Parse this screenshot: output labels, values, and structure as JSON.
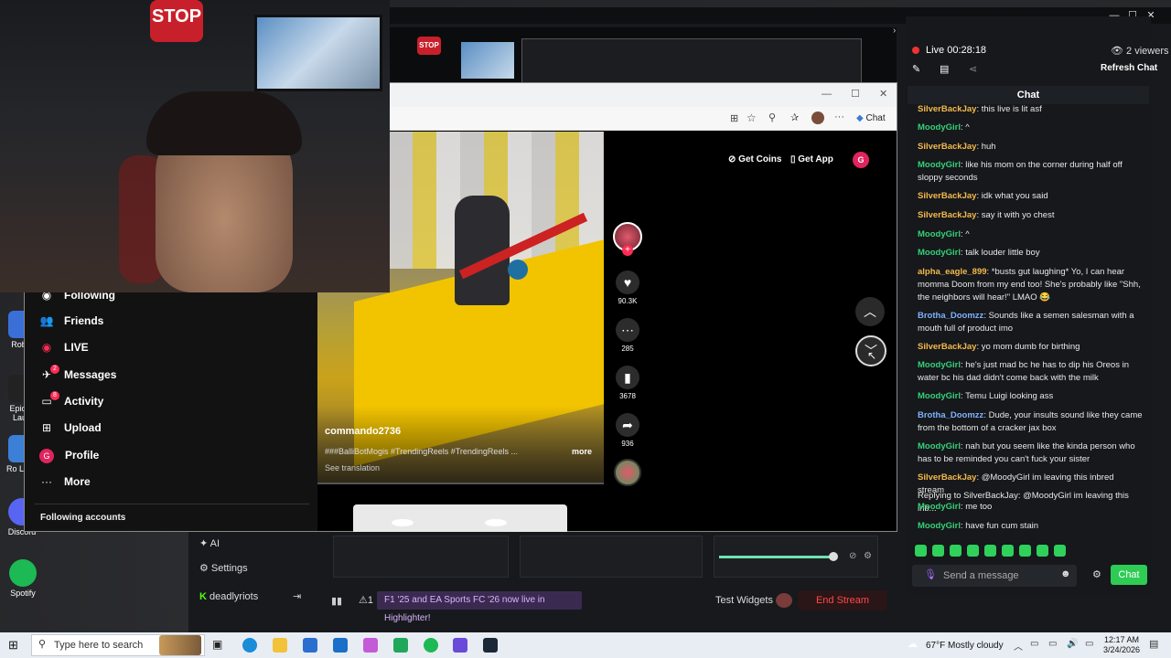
{
  "desktop": {
    "icons": [
      {
        "label": "Roblo"
      },
      {
        "label": "Epic G Laun"
      },
      {
        "label": "Ro Leag"
      },
      {
        "label": "Discord"
      },
      {
        "label": "Spotify"
      }
    ]
  },
  "webcam": {
    "stop_text": "STOP"
  },
  "stream_app": {
    "preview_stop": "STOP",
    "menu": [
      {
        "label": "AI"
      },
      {
        "label": "Settings"
      },
      {
        "label": "deadlyriots"
      }
    ],
    "ticker": "F1 '25 and EA Sports FC '26 now live in Highlighter!",
    "alert_count": "1",
    "test_widgets": "Test Widgets",
    "end_stream": "End Stream"
  },
  "chat": {
    "live_label": "Live 00:28:18",
    "viewers": "2 viewers",
    "refresh": "Refresh Chat",
    "header": "Chat",
    "messages": [
      {
        "user": "SilverBackJay",
        "text": ": this live is lit asf",
        "color": "#f5b94c"
      },
      {
        "user": "MoodyGirl",
        "text": ": ^",
        "color": "#36d07a"
      },
      {
        "user": "SilverBackJay",
        "text": ": huh",
        "color": "#f5b94c"
      },
      {
        "user": "MoodyGirl",
        "text": ": like his mom on the corner during half off sloppy seconds",
        "color": "#36d07a"
      },
      {
        "user": "SilverBackJay",
        "text": ": idk what you said",
        "color": "#f5b94c"
      },
      {
        "user": "SilverBackJay",
        "text": ": say it with yo chest",
        "color": "#f5b94c"
      },
      {
        "user": "MoodyGirl",
        "text": ": ^",
        "color": "#36d07a"
      },
      {
        "user": "MoodyGirl",
        "text": ": talk louder little boy",
        "color": "#36d07a"
      },
      {
        "user": "alpha_eagle_899",
        "text": ": *busts gut laughing* Yo, I can hear momma Doom from my end too! She's probably like \"Shh, the neighbors will hear!\" LMAO 😂",
        "color": "#f5b94c"
      },
      {
        "user": "Brotha_Doomzz",
        "text": ": Sounds like a semen salesman with a mouth full of product imo",
        "color": "#7fb2ff"
      },
      {
        "user": "SilverBackJay",
        "text": ": yo mom dumb for birthing",
        "color": "#f5b94c"
      },
      {
        "user": "MoodyGirl",
        "text": ": he's just mad bc he has to dip his Oreos in water bc his dad didn't come back with the milk",
        "color": "#36d07a"
      },
      {
        "user": "MoodyGirl",
        "text": ": Temu Luigi looking ass",
        "color": "#36d07a"
      },
      {
        "user": "Brotha_Doomzz",
        "text": ": Dude, your insults sound like they came from the bottom of a cracker jax box",
        "color": "#7fb2ff"
      },
      {
        "user": "MoodyGirl",
        "text": ": nah but you seem like the kinda person who has to be reminded you can't fuck your sister",
        "color": "#36d07a"
      },
      {
        "user": "SilverBackJay",
        "text": ": @MoodyGirl im leaving this inbred stream",
        "color": "#f5b94c"
      }
    ],
    "reply_note": "Replying to SilverBackJay: @MoodyGirl im leaving this inb...",
    "messages_tail": [
      {
        "user": "MoodyGirl",
        "text": ": me too",
        "color": "#36d07a"
      },
      {
        "user": "MoodyGirl",
        "text": ": have fun cum stain",
        "color": "#36d07a"
      }
    ],
    "send_placeholder": "Send a message",
    "send_button": "Chat"
  },
  "browser": {
    "copilot": "Chat",
    "top_buttons": {
      "coins": "Get Coins",
      "app": "Get App",
      "profile_letter": "G"
    }
  },
  "tiktok_sidebar": {
    "items": [
      {
        "label": "Following",
        "icon": "following-icon",
        "glyph": "◉"
      },
      {
        "label": "Friends",
        "icon": "friends-icon",
        "glyph": "👥"
      },
      {
        "label": "LIVE",
        "icon": "live-icon",
        "glyph": "◉"
      },
      {
        "label": "Messages",
        "icon": "messages-icon",
        "glyph": "✈"
      },
      {
        "label": "Activity",
        "icon": "activity-icon",
        "glyph": "▭"
      },
      {
        "label": "Upload",
        "icon": "upload-icon",
        "glyph": "⊞"
      },
      {
        "label": "Profile",
        "icon": "profile-icon",
        "glyph": "G"
      },
      {
        "label": "More",
        "icon": "more-icon",
        "glyph": "···"
      }
    ],
    "messages_badge": "2",
    "activity_badge": "8",
    "following_accounts": "Following accounts"
  },
  "video": {
    "username": "commando2736",
    "caption": "###BalliBotMogis #TrendingReels #TrendingReels ...",
    "more": "more",
    "translate": "See translation",
    "likes": "90.3K",
    "comments": "285",
    "saves": "3678",
    "shares": "936"
  },
  "taskbar": {
    "search_placeholder": "Type here to search",
    "weather": "67°F  Mostly cloudy",
    "time": "12:17 AM",
    "date": "3/24/2026"
  }
}
